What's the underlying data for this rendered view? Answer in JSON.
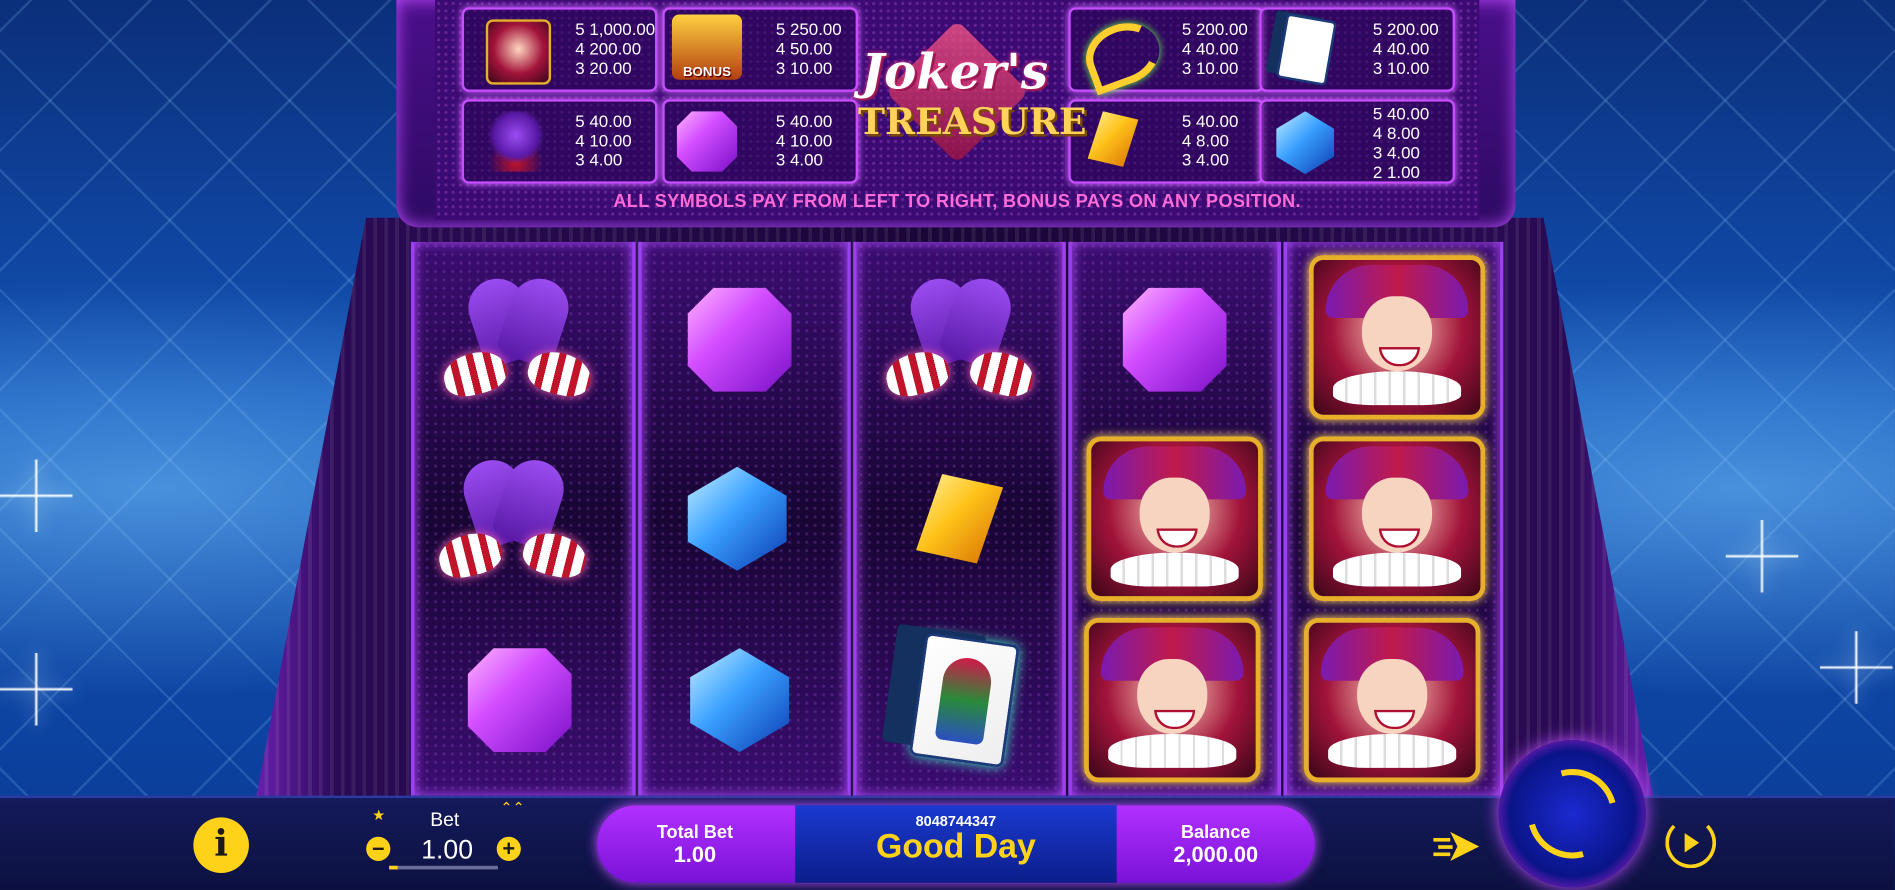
{
  "game": {
    "logo_line1": "Joker's",
    "logo_line2": "TREASURE",
    "rule_text": "ALL SYMBOLS PAY FROM LEFT TO RIGHT, BONUS PAYS ON ANY POSITION."
  },
  "paytable": [
    {
      "symbol": "joker",
      "lines": [
        "5 1,000.00",
        "4 200.00",
        "3 20.00"
      ]
    },
    {
      "symbol": "bonus-crown",
      "label": "BONUS",
      "lines": [
        "5 250.00",
        "4 50.00",
        "3 10.00"
      ]
    },
    {
      "symbol": "horn",
      "lines": [
        "5 200.00",
        "4 40.00",
        "3 10.00"
      ]
    },
    {
      "symbol": "joker-card",
      "lines": [
        "5 200.00",
        "4 40.00",
        "3 10.00"
      ]
    },
    {
      "symbol": "gloves",
      "lines": [
        "5 40.00",
        "4 10.00",
        "3 4.00"
      ]
    },
    {
      "symbol": "purple-gem",
      "lines": [
        "5 40.00",
        "4 10.00",
        "3 4.00"
      ]
    },
    {
      "symbol": "yellow-gem",
      "lines": [
        "5 40.00",
        "4 8.00",
        "3 4.00"
      ]
    },
    {
      "symbol": "blue-gem",
      "lines": [
        "5 40.00",
        "4 8.00",
        "3 4.00",
        "2 1.00"
      ]
    }
  ],
  "reels": [
    [
      "gloves",
      "gloves",
      "purple-gem"
    ],
    [
      "purple-gem",
      "blue-gem",
      "blue-gem"
    ],
    [
      "gloves",
      "yellow-gem",
      "joker-card"
    ],
    [
      "purple-gem",
      "joker",
      "joker"
    ],
    [
      "joker",
      "joker",
      "joker"
    ]
  ],
  "controls": {
    "bet_label": "Bet",
    "bet_value": "1.00",
    "bet_fraction": 0.08,
    "total_bet_label": "Total Bet",
    "total_bet_value": "1.00",
    "message_id": "8048744347",
    "message": "Good Day",
    "balance_label": "Balance",
    "balance_value": "2,000.00"
  },
  "icons": {
    "info": "i",
    "minus": "−",
    "plus": "+",
    "star": "★",
    "max_up": "⌃⌃"
  },
  "colors": {
    "accent_yellow": "#ffd21a",
    "pill_purple": "#9a20f0",
    "pill_blue": "#1a3ad0",
    "rule_pink": "#ff6bd8"
  }
}
